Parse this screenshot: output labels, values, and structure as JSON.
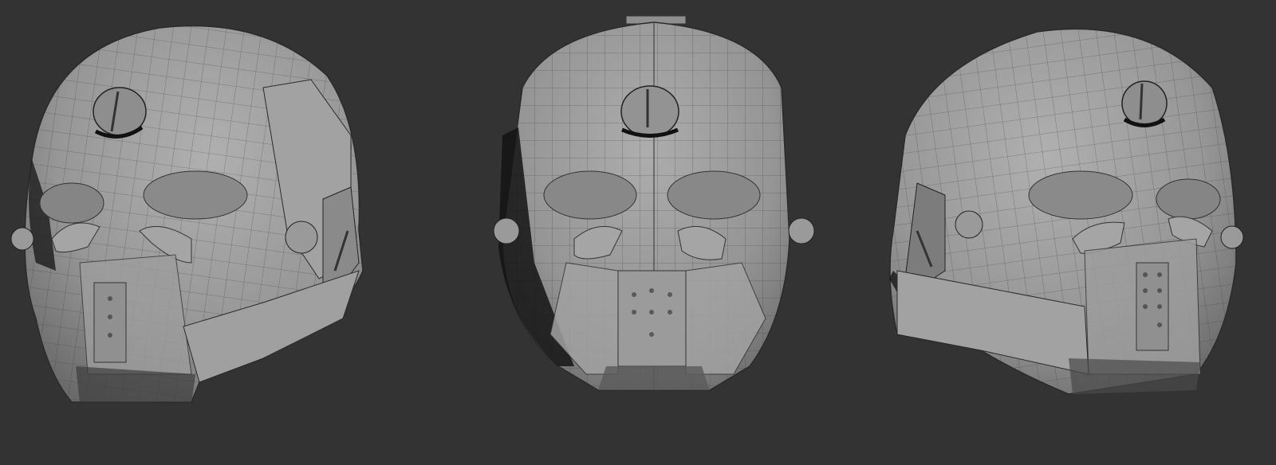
{
  "viewport": {
    "background_color": "#333333",
    "views": [
      {
        "id": "three-quarter-left",
        "subject": "helmet-mask"
      },
      {
        "id": "front",
        "subject": "helmet-mask"
      },
      {
        "id": "three-quarter-right",
        "subject": "helmet-mask"
      }
    ]
  },
  "colors": {
    "surface": "#9a9a9a",
    "surface_light": "#a8a8a8",
    "surface_dark": "#6f6f6f",
    "wire": "#3a3a3a",
    "shadow": "#111111"
  }
}
